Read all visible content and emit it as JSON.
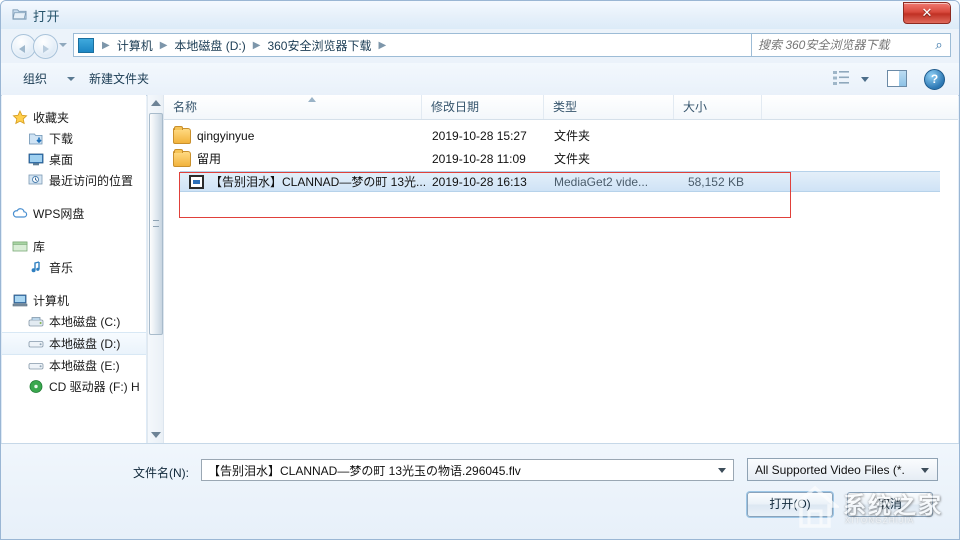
{
  "window": {
    "title": "打开",
    "title_icon": "open-folder-icon",
    "close_label": "✕"
  },
  "nav": {
    "back_icon": "back-arrow-icon",
    "forward_icon": "forward-arrow-icon",
    "history_icon": "history-dropdown-icon",
    "address_icon": "folder-icon",
    "breadcrumbs": [
      "计算机",
      "本地磁盘 (D:)",
      "360安全浏览器下载"
    ],
    "separator": "▶",
    "address_dropdown_icon": "chevron-down-icon",
    "refresh_icon": "refresh-icon",
    "refresh_glyph": "↻"
  },
  "search": {
    "placeholder": "搜索 360安全浏览器下载",
    "value": "",
    "icon": "search-icon",
    "glyph": "⌕"
  },
  "toolbar": {
    "organize_label": "组织",
    "organize_dropdown_icon": "chevron-down-icon",
    "new_folder_label": "新建文件夹",
    "view_icon": "view-mode-icon",
    "view_dropdown_icon": "chevron-down-icon",
    "preview_icon": "preview-pane-icon",
    "help_icon": "help-icon",
    "help_glyph": "?"
  },
  "sidebar": {
    "groups": [
      {
        "header": {
          "label": "收藏夹",
          "icon": "star-icon"
        },
        "items": [
          {
            "label": "下载",
            "icon": "downloads-icon",
            "selected": false
          },
          {
            "label": "桌面",
            "icon": "desktop-icon",
            "selected": false
          },
          {
            "label": "最近访问的位置",
            "icon": "recent-places-icon",
            "selected": false
          }
        ]
      },
      {
        "header": {
          "label": "WPS网盘",
          "icon": "cloud-icon"
        },
        "items": []
      },
      {
        "header": {
          "label": "库",
          "icon": "library-icon"
        },
        "items": [
          {
            "label": "音乐",
            "icon": "music-icon",
            "selected": false
          }
        ]
      },
      {
        "header": {
          "label": "计算机",
          "icon": "computer-icon"
        },
        "items": [
          {
            "label": "本地磁盘 (C:)",
            "icon": "system-drive-icon",
            "selected": false
          },
          {
            "label": "本地磁盘 (D:)",
            "icon": "drive-icon",
            "selected": true
          },
          {
            "label": "本地磁盘 (E:)",
            "icon": "drive-icon",
            "selected": false
          },
          {
            "label": "CD 驱动器 (F:) H",
            "icon": "cd-drive-icon",
            "selected": false
          }
        ]
      }
    ],
    "scrollbar": {
      "up_icon": "scroll-up-arrow-icon",
      "down_icon": "scroll-down-arrow-icon"
    }
  },
  "filelist": {
    "columns": [
      {
        "label": "名称",
        "key": "name"
      },
      {
        "label": "修改日期",
        "key": "date"
      },
      {
        "label": "类型",
        "key": "type"
      },
      {
        "label": "大小",
        "key": "size"
      }
    ],
    "sort_indicator": "ascending",
    "rows": [
      {
        "name": "qingyinyue",
        "date": "2019-10-28 15:27",
        "type": "文件夹",
        "size": "",
        "icon": "folder-icon",
        "selected": false
      },
      {
        "name": "留用",
        "date": "2019-10-28 11:09",
        "type": "文件夹",
        "size": "",
        "icon": "folder-icon",
        "selected": false
      },
      {
        "name": "【告别泪水】CLANNAD—梦の町 13光...",
        "date": "2019-10-28 16:13",
        "type": "MediaGet2 vide...",
        "size": "58,152 KB",
        "icon": "video-file-icon",
        "selected": true
      }
    ],
    "annotation_color": "#e0403a"
  },
  "bottom": {
    "filename_label": "文件名(N):",
    "filename_value": "【告别泪水】CLANNAD—梦の町 13光玉の物语.296045.flv",
    "filename_dropdown_icon": "chevron-down-icon",
    "filetype_value": "All Supported Video Files (*.",
    "filetype_dropdown_icon": "chevron-down-icon",
    "open_label": "打开(O)",
    "cancel_label": "取消"
  },
  "watermark": {
    "text": "系统之家",
    "subtext": "XITONGZHIJIA",
    "icon": "house-logo-icon"
  },
  "colors": {
    "accent": "#2d78b4",
    "selection": "#cfe3f6",
    "annotation": "#e0403a",
    "close_button": "#c03124"
  }
}
